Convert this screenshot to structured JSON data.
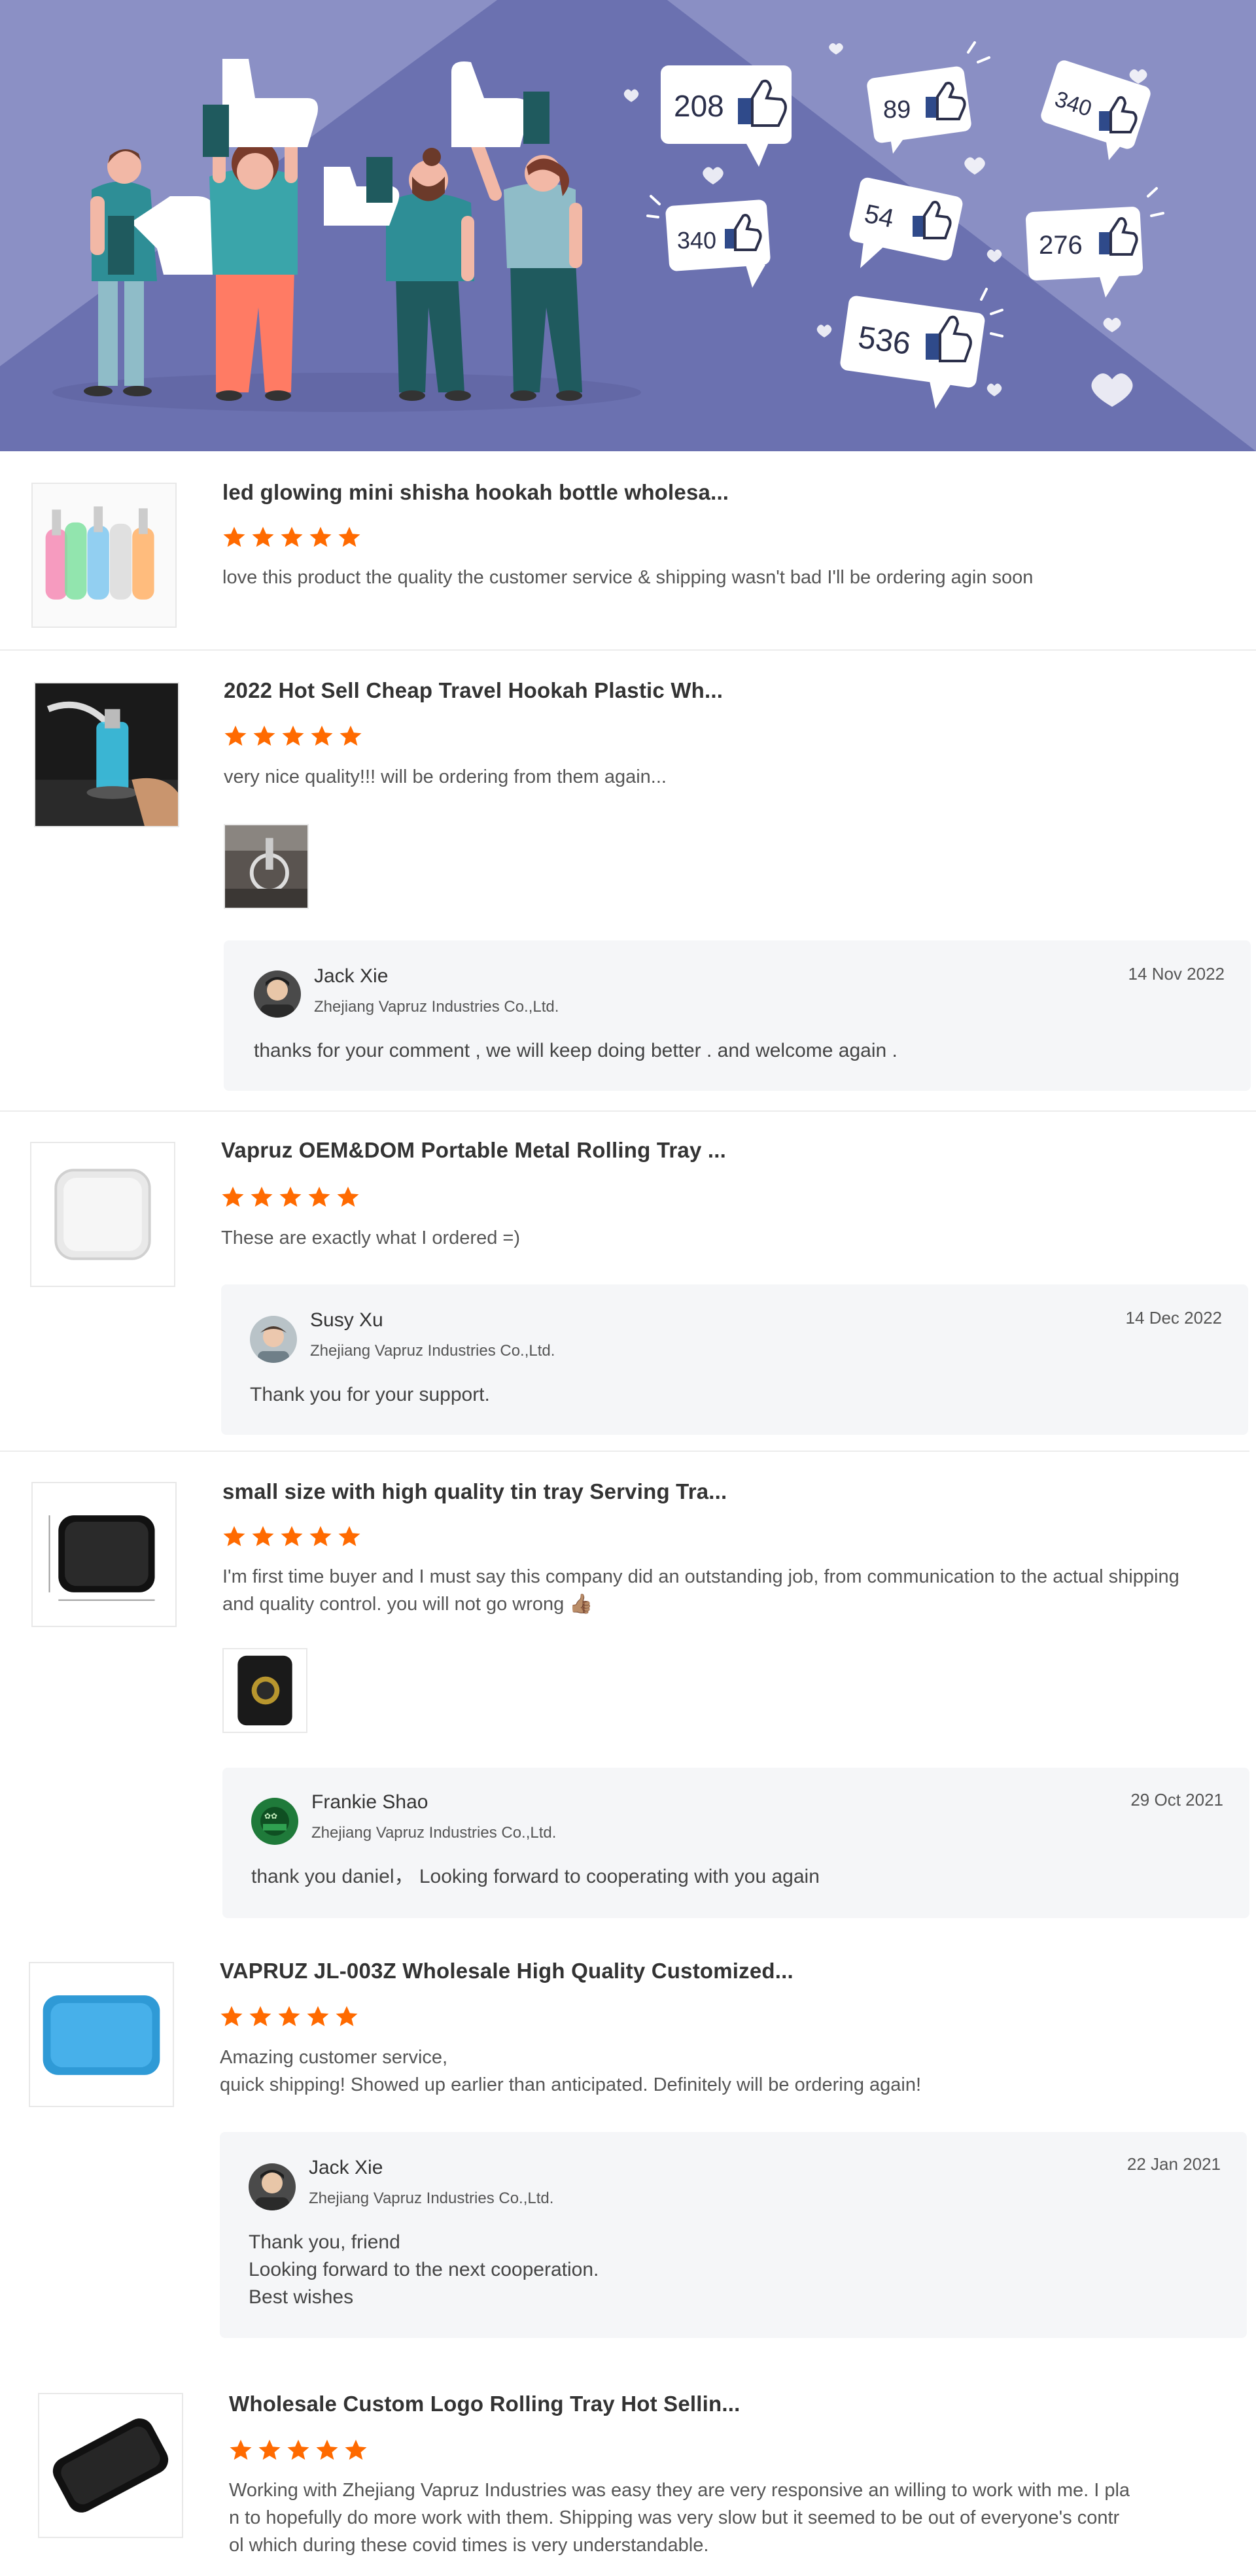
{
  "banner": {
    "colors": {
      "background_light": "#8a8fc4",
      "background_dark": "#6b71b0",
      "accent": "#2f4a8a"
    },
    "like_counts": [
      "208",
      "89",
      "340",
      "340",
      "54",
      "276",
      "536"
    ]
  },
  "colors": {
    "star": "#ff6a00",
    "reply_bg": "#f5f6f8",
    "divider": "#ececec"
  },
  "reviews": [
    {
      "title": "led glowing mini shisha hookah bottle wholesa...",
      "rating": 5,
      "comment": "love this product the quality the customer service & shipping wasn't bad I'll be ordering agin soon",
      "thumbnail_icon": "colorful-hookah-bottles-image"
    },
    {
      "title": "2022 Hot Sell Cheap Travel Hookah Plastic Wh...",
      "rating": 5,
      "comment": "very nice quality!!! will be ordering from them again...",
      "thumbnail_icon": "car-cup-hookah-image",
      "attachment_icon": "hookah-photo-attachment",
      "reply": {
        "name": "Jack Xie",
        "company": "Zhejiang Vapruz Industries Co.,Ltd.",
        "date": "14 Nov 2022",
        "text": "thanks for your comment , we will keep doing better . and welcome again ."
      }
    },
    {
      "title": "Vapruz OEM&DOM Portable Metal Rolling Tray ...",
      "rating": 5,
      "comment": "These are exactly what I ordered =)",
      "thumbnail_icon": "white-rolling-tray-image",
      "reply": {
        "name": "Susy Xu",
        "company": "Zhejiang Vapruz Industries Co.,Ltd.",
        "date": "14 Dec 2022",
        "text": "Thank you for your support."
      }
    },
    {
      "title": "small size with high quality tin tray Serving Tra...",
      "rating": 5,
      "comment": "I'm first time buyer and I must say this company did an outstanding job, from communication to the actual shipping and quality control. you will not go wrong 👍🏽",
      "thumbnail_icon": "black-tin-tray-image",
      "attachment_icon": "tray-photo-attachment",
      "reply": {
        "name": "Frankie Shao",
        "company": "Zhejiang Vapruz Industries Co.,Ltd.",
        "date": "29 Oct 2021",
        "text": "thank you daniel， Looking forward to cooperating with you again"
      }
    },
    {
      "title": "VAPRUZ JL-003Z Wholesale High Quality Customized...",
      "rating": 5,
      "comment": "Amazing customer service,\nquick shipping! Showed up earlier than anticipated. Definitely will be ordering again!",
      "thumbnail_icon": "blue-rolling-tray-image",
      "reply": {
        "name": "Jack Xie",
        "company": "Zhejiang Vapruz Industries Co.,Ltd.",
        "date": "22 Jan 2021",
        "text": "Thank you, friend\nLooking forward to the next cooperation.\nBest wishes"
      }
    },
    {
      "title": "Wholesale Custom Logo Rolling Tray Hot Sellin...",
      "rating": 5,
      "comment": "Working with Zhejiang Vapruz Industries was easy they are very responsive an willing to work with me. I pla\nn to hopefully do more work with them. Shipping was very slow but it seemed to be out of everyone's contr\nol which during these covid times is very understandable.",
      "thumbnail_icon": "black-rolling-tray-image"
    }
  ]
}
